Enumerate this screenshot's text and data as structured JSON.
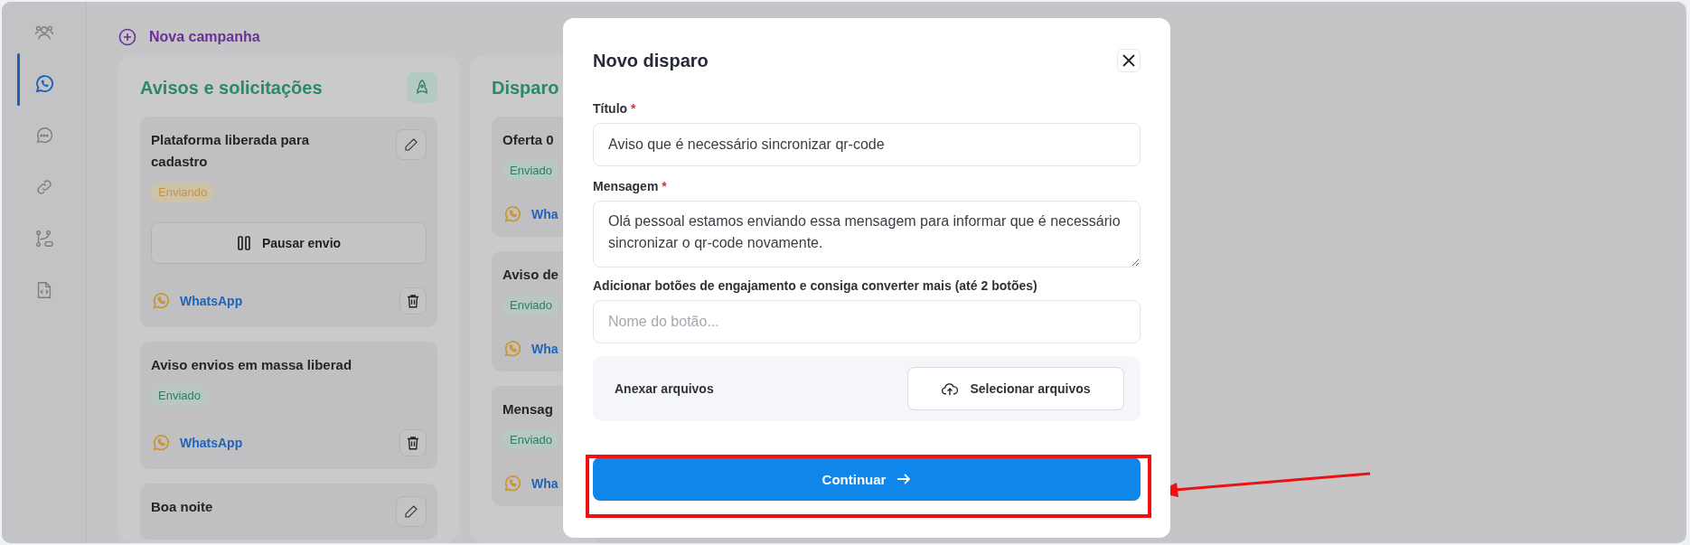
{
  "sidebar": {
    "items": [
      {
        "kind": "users",
        "selected": false
      },
      {
        "kind": "whatsapp",
        "selected": true
      },
      {
        "kind": "chat",
        "selected": false
      },
      {
        "kind": "link",
        "selected": false
      },
      {
        "kind": "flow",
        "selected": false
      },
      {
        "kind": "code",
        "selected": false
      }
    ]
  },
  "new_campaign": "Nova campanha",
  "columns": [
    {
      "title": "Avisos e solicitações",
      "has_launch": true,
      "cards": [
        {
          "title": "Plataforma liberada para cadastro",
          "editable": true,
          "status": {
            "label": "Enviando",
            "kind": "sending"
          },
          "action": "Pausar envio",
          "channel": "WhatsApp",
          "deletable": true
        },
        {
          "title": "Aviso envios em massa liberad",
          "editable": false,
          "status": {
            "label": "Enviado",
            "kind": "sent"
          },
          "channel": "WhatsApp",
          "deletable": true
        },
        {
          "title": "Boa noite",
          "editable": true
        }
      ]
    },
    {
      "title": "Disparo",
      "cards": [
        {
          "title": "Oferta 0",
          "status": {
            "label": "Enviado",
            "kind": "sent"
          },
          "channel": "Wha"
        },
        {
          "title": "Aviso de",
          "status": {
            "label": "Enviado",
            "kind": "sent"
          },
          "channel": "Wha"
        },
        {
          "title": "Mensag",
          "status": {
            "label": "Enviado",
            "kind": "sent"
          },
          "channel": "Wha"
        }
      ]
    }
  ],
  "modal": {
    "title": "Novo disparo",
    "title_field": {
      "label": "Título",
      "required_mark": "*",
      "value": "Aviso que é necessário sincronizar qr-code"
    },
    "message_field": {
      "label": "Mensagem",
      "required_mark": "*",
      "value": "Olá pessoal estamos enviando essa mensagem para informar que é necessário sincronizar o qr-code novamente."
    },
    "buttons_field": {
      "label": "Adicionar botões de engajamento e consiga converter mais (até 2 botões)",
      "placeholder": "Nome do botão..."
    },
    "attach": {
      "label": "Anexar arquivos",
      "button": "Selecionar arquivos"
    },
    "submit": "Continuar"
  },
  "annotation": {
    "highlight": true,
    "arrow": true
  }
}
